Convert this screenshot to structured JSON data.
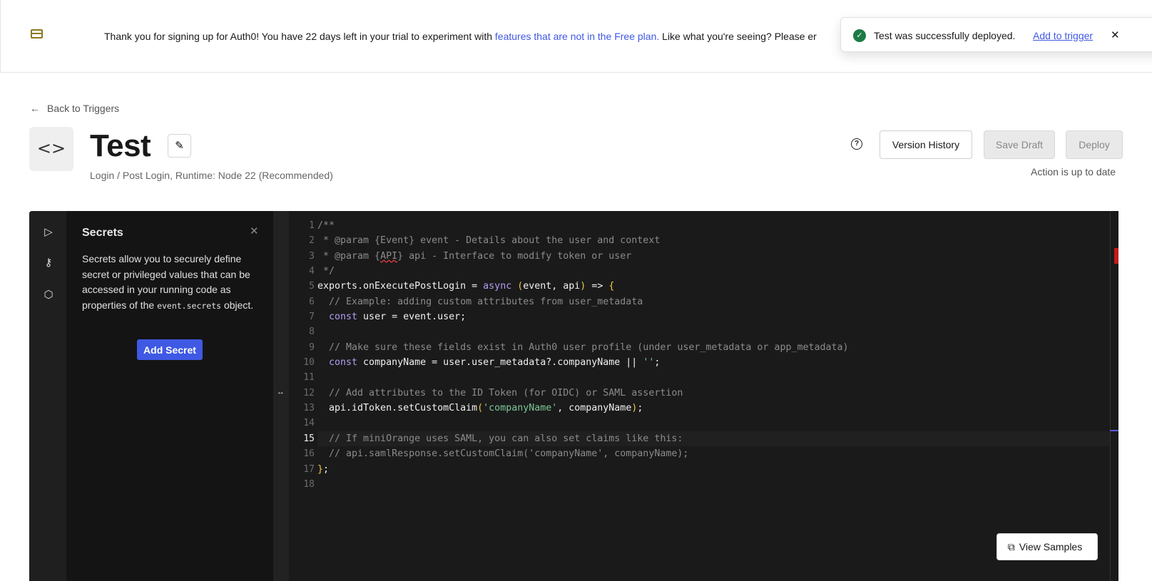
{
  "banner": {
    "icon": "credit-card-icon",
    "text_before": "Thank you for signing up for Auth0! You have 22 days left in your trial to experiment with ",
    "link": "features that are not in the Free plan.",
    "text_after": " Like what you're seeing? Please er"
  },
  "toast": {
    "icon": "check-circle-icon",
    "message": "Test was successfully deployed.",
    "link": "Add to trigger",
    "close": "✕"
  },
  "header": {
    "back_label": "Back to Triggers",
    "title": "Test",
    "subtitle": "Login / Post Login, Runtime: Node 22 (Recommended)",
    "status": "Action is up to date",
    "buttons": {
      "version_history": "Version History",
      "save_draft": "Save Draft",
      "deploy": "Deploy"
    }
  },
  "secrets": {
    "title": "Secrets",
    "desc_before": "Secrets allow you to securely define secret or privileged values that can be accessed in your running code as properties of the ",
    "desc_code": "event.secrets",
    "desc_after": " object.",
    "add_button": "Add Secret"
  },
  "rail": [
    "play-icon",
    "key-icon",
    "package-icon"
  ],
  "editor": {
    "current_line": 15,
    "lines": [
      [
        [
          "comment",
          "/**"
        ]
      ],
      [
        [
          "comment",
          " * @param {Event} event - Details about the user and context"
        ]
      ],
      [
        [
          "comment",
          " * @param {"
        ],
        [
          "err",
          "API"
        ],
        [
          "comment",
          "} api - Interface to modify token or user"
        ]
      ],
      [
        [
          "comment",
          " */"
        ]
      ],
      [
        [
          "text",
          "exports.onExecutePostLogin = "
        ],
        [
          "keyword",
          "async"
        ],
        [
          "text",
          " "
        ],
        [
          "paren",
          "("
        ],
        [
          "text",
          "event, api"
        ],
        [
          "paren",
          ")"
        ],
        [
          "text",
          " => "
        ],
        [
          "paren",
          "{"
        ]
      ],
      [
        [
          "comment",
          "  // Example: adding custom attributes from user_metadata"
        ]
      ],
      [
        [
          "keyword",
          "  const"
        ],
        [
          "text",
          " user = event.user;"
        ]
      ],
      [],
      [
        [
          "comment",
          "  // Make sure these fields exist in Auth0 user profile (under user_metadata or app_metadata)"
        ]
      ],
      [
        [
          "keyword",
          "  const"
        ],
        [
          "text",
          " companyName = user.user_metadata?.companyName || "
        ],
        [
          "string",
          "''"
        ],
        [
          "text",
          ";"
        ]
      ],
      [],
      [
        [
          "comment",
          "  // Add attributes to the ID Token (for OIDC) or SAML assertion"
        ]
      ],
      [
        [
          "text",
          "  api.idToken.setCustomClaim"
        ],
        [
          "paren",
          "("
        ],
        [
          "string",
          "'companyName'"
        ],
        [
          "text",
          ", companyName"
        ],
        [
          "paren",
          ")"
        ],
        [
          "text",
          ";"
        ]
      ],
      [],
      [
        [
          "comment",
          "  // If miniOrange uses SAML, you can also set claims like this:"
        ]
      ],
      [
        [
          "comment",
          "  // api.samlResponse.setCustomClaim('companyName', companyName);"
        ]
      ],
      [
        [
          "paren",
          "}"
        ],
        [
          "text",
          ";"
        ]
      ],
      []
    ]
  },
  "view_samples": "View Samples"
}
